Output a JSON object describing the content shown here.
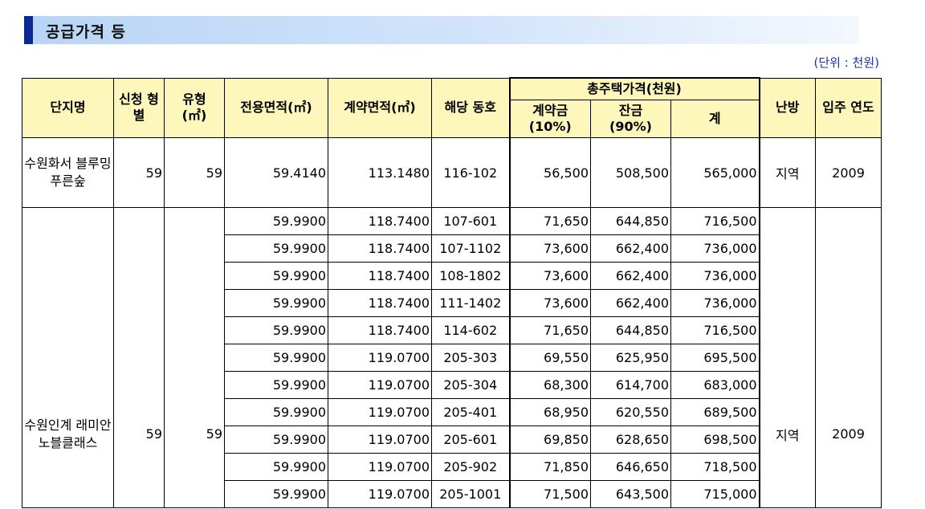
{
  "section": {
    "title": "공급가격 등"
  },
  "unit_note": "(단위 : 천원)",
  "headers": {
    "complex": "단지명",
    "applicant_type": "신청 형별",
    "type": "유형",
    "type_unit": "(㎡)",
    "exclusive_area": "전용면적(㎡)",
    "contract_area": "계약면적(㎡)",
    "building_unit": "해당 동호",
    "total_price": "총주택가격(천원)",
    "deposit": "계약금",
    "deposit_pct": "(10%)",
    "balance": "잔금",
    "balance_pct": "(90%)",
    "sum": "계",
    "heating": "난방",
    "move_in": "입주 연도"
  },
  "groups": [
    {
      "name": "수원화서 블루밍 푸른숲",
      "applicant_type": "59",
      "type": "59",
      "heating": "지역",
      "move_in": "2009",
      "rows": [
        {
          "exclusive": "59.4140",
          "contract": "113.1480",
          "unit": "116-102",
          "deposit": "56,500",
          "balance": "508,500",
          "total": "565,000"
        }
      ]
    },
    {
      "name": "수원인계 래미안 노블클래스",
      "applicant_type": "59",
      "type": "59",
      "heating": "지역",
      "move_in": "2009",
      "rows": [
        {
          "exclusive": "59.9900",
          "contract": "118.7400",
          "unit": "107-601",
          "deposit": "71,650",
          "balance": "644,850",
          "total": "716,500"
        },
        {
          "exclusive": "59.9900",
          "contract": "118.7400",
          "unit": "107-1102",
          "deposit": "73,600",
          "balance": "662,400",
          "total": "736,000"
        },
        {
          "exclusive": "59.9900",
          "contract": "118.7400",
          "unit": "108-1802",
          "deposit": "73,600",
          "balance": "662,400",
          "total": "736,000"
        },
        {
          "exclusive": "59.9900",
          "contract": "118.7400",
          "unit": "111-1402",
          "deposit": "73,600",
          "balance": "662,400",
          "total": "736,000"
        },
        {
          "exclusive": "59.9900",
          "contract": "118.7400",
          "unit": "114-602",
          "deposit": "71,650",
          "balance": "644,850",
          "total": "716,500"
        },
        {
          "exclusive": "59.9900",
          "contract": "119.0700",
          "unit": "205-303",
          "deposit": "69,550",
          "balance": "625,950",
          "total": "695,500"
        },
        {
          "exclusive": "59.9900",
          "contract": "119.0700",
          "unit": "205-304",
          "deposit": "68,300",
          "balance": "614,700",
          "total": "683,000"
        },
        {
          "exclusive": "59.9900",
          "contract": "119.0700",
          "unit": "205-401",
          "deposit": "68,950",
          "balance": "620,550",
          "total": "689,500"
        },
        {
          "exclusive": "59.9900",
          "contract": "119.0700",
          "unit": "205-601",
          "deposit": "69,850",
          "balance": "628,650",
          "total": "698,500"
        },
        {
          "exclusive": "59.9900",
          "contract": "119.0700",
          "unit": "205-902",
          "deposit": "71,850",
          "balance": "646,650",
          "total": "718,500"
        },
        {
          "exclusive": "59.9900",
          "contract": "119.0700",
          "unit": "205-1001",
          "deposit": "71,500",
          "balance": "643,500",
          "total": "715,000"
        }
      ]
    }
  ]
}
